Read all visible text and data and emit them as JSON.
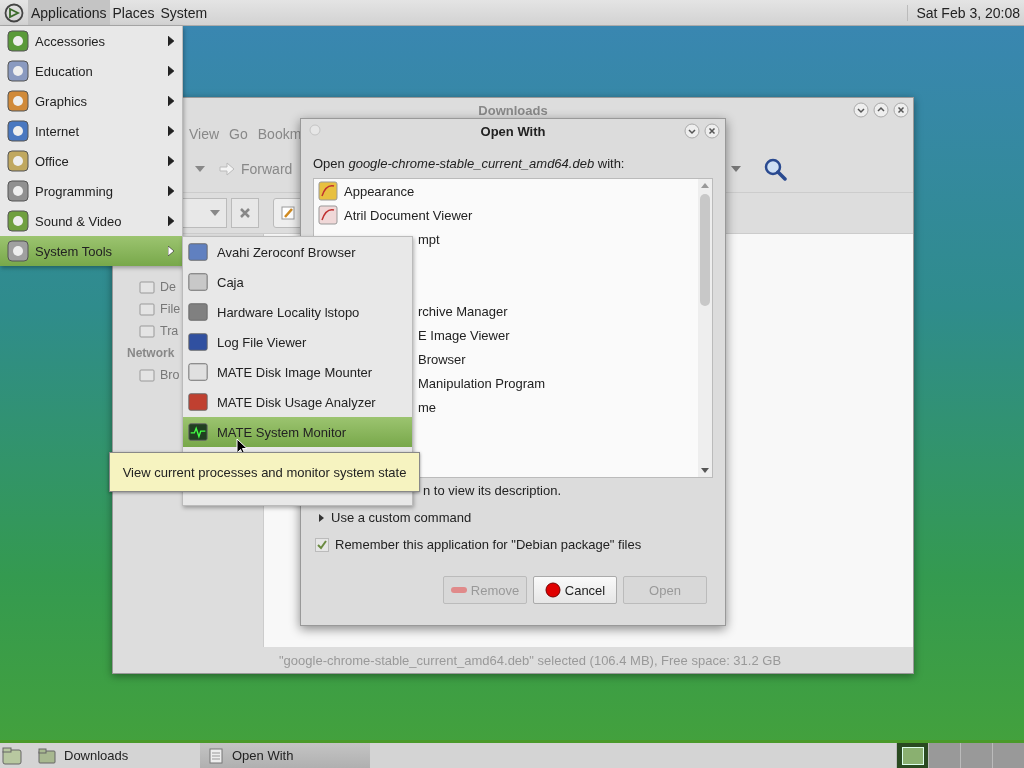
{
  "top_panel": {
    "menus": [
      {
        "label": "Applications",
        "selected": true
      },
      {
        "label": "Places",
        "selected": false
      },
      {
        "label": "System",
        "selected": false
      }
    ],
    "clock": "Sat Feb 3, 20:08"
  },
  "file_manager": {
    "title": "Downloads",
    "menu_items": [
      "View",
      "Go",
      "Bookm"
    ],
    "forward_button": "Forward",
    "sidebar": [
      {
        "kind": "item",
        "label": "De"
      },
      {
        "kind": "item",
        "label": "File"
      },
      {
        "kind": "item",
        "label": "Tra"
      },
      {
        "kind": "heading",
        "label": "Network"
      },
      {
        "kind": "item",
        "label": "Bro"
      }
    ],
    "status": "\"google-chrome-stable_current_amd64.deb\" selected (106.4 MB), Free space: 31.2 GB"
  },
  "dialog": {
    "title": "Open With",
    "prompt": "Open *google-chrome-stable_current_amd64.deb* with:",
    "apps": [
      {
        "kind": "app",
        "label": "Appearance"
      },
      {
        "kind": "app",
        "label": "Atril Document Viewer"
      },
      {
        "kind": "partial",
        "label": "mpt"
      },
      {
        "kind": "partial",
        "label": "rchive Manager"
      },
      {
        "kind": "partial",
        "label": "E Image Viewer"
      },
      {
        "kind": "partial",
        "label": "Browser"
      },
      {
        "kind": "partial",
        "label": "Manipulation Program"
      },
      {
        "kind": "partial",
        "label": "me"
      }
    ],
    "description_hint": "n to view its description.",
    "expander": {
      "label": "Use a custom command",
      "expanded": false
    },
    "remember": {
      "label": "Remember this application for \"Debian package\" files",
      "checked": true
    },
    "buttons": [
      {
        "label": "Remove",
        "kind": "remove",
        "disabled": true
      },
      {
        "label": "Cancel",
        "kind": "cancel",
        "disabled": false
      },
      {
        "label": "Open",
        "kind": "plain",
        "disabled": true
      }
    ]
  },
  "applications_menu": [
    {
      "label": "Accessories",
      "selected": false
    },
    {
      "label": "Education",
      "selected": false
    },
    {
      "label": "Graphics",
      "selected": false
    },
    {
      "label": "Internet",
      "selected": false
    },
    {
      "label": "Office",
      "selected": false
    },
    {
      "label": "Programming",
      "selected": false
    },
    {
      "label": "Sound & Video",
      "selected": false
    },
    {
      "label": "System Tools",
      "selected": true
    }
  ],
  "submenu": [
    {
      "label": "Avahi Zeroconf Browser",
      "selected": false
    },
    {
      "label": "Caja",
      "selected": false
    },
    {
      "label": "Hardware Locality lstopo",
      "selected": false
    },
    {
      "label": "Log File Viewer",
      "selected": false
    },
    {
      "label": "MATE Disk Image Mounter",
      "selected": false
    },
    {
      "label": "MATE Disk Usage Analyzer",
      "selected": false
    },
    {
      "label": "MATE System Monitor",
      "selected": true
    }
  ],
  "tooltip": "View current processes and monitor system state",
  "taskbar": [
    {
      "label": "Downloads",
      "selected": false
    },
    {
      "label": "Open With",
      "selected": true
    }
  ],
  "workspaces": [
    {
      "selected": true
    },
    {
      "selected": false
    },
    {
      "selected": false
    },
    {
      "selected": false
    }
  ]
}
